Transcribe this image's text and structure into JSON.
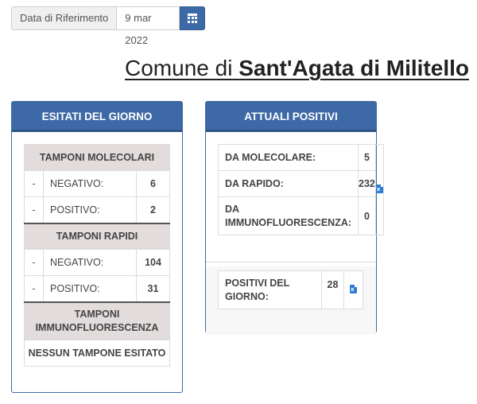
{
  "date": {
    "label": "Data di Riferimento",
    "value": "9 mar 2022",
    "button_icon": "calendar-icon"
  },
  "title": {
    "prefix": "Comune di",
    "name": "Sant'Agata di Militello"
  },
  "esitati": {
    "heading": "ESITATI DEL GIORNO",
    "molecolari": {
      "title": "TAMPONI MOLECOLARI",
      "rows": [
        {
          "dash": "-",
          "label": "NEGATIVO:",
          "value": "6"
        },
        {
          "dash": "-",
          "label": "POSITIVO:",
          "value": "2"
        }
      ]
    },
    "rapidi": {
      "title": "TAMPONI RAPIDI",
      "rows": [
        {
          "dash": "-",
          "label": "NEGATIVO:",
          "value": "104"
        },
        {
          "dash": "-",
          "label": "POSITIVO:",
          "value": "31"
        }
      ]
    },
    "immuno": {
      "title": "TAMPONI IMMUNOFLUORESCENZA",
      "none_text": "NESSUN TAMPONE ESITATO"
    }
  },
  "attuali": {
    "heading": "ATTUALI POSITIVI",
    "rows": [
      {
        "label": "DA MOLECOLARE:",
        "value": "5"
      },
      {
        "label": "DA RAPIDO:",
        "value": "232"
      },
      {
        "label": "DA IMMUNOFLUORESCENZA:",
        "value": "0"
      }
    ],
    "export_icon": "excel-file-icon",
    "positivi_giorno": {
      "label": "POSITIVI DEL GIORNO:",
      "value": "28"
    }
  },
  "colors": {
    "accent": "#3d6aa6",
    "section_bg": "#e2dcdc"
  }
}
